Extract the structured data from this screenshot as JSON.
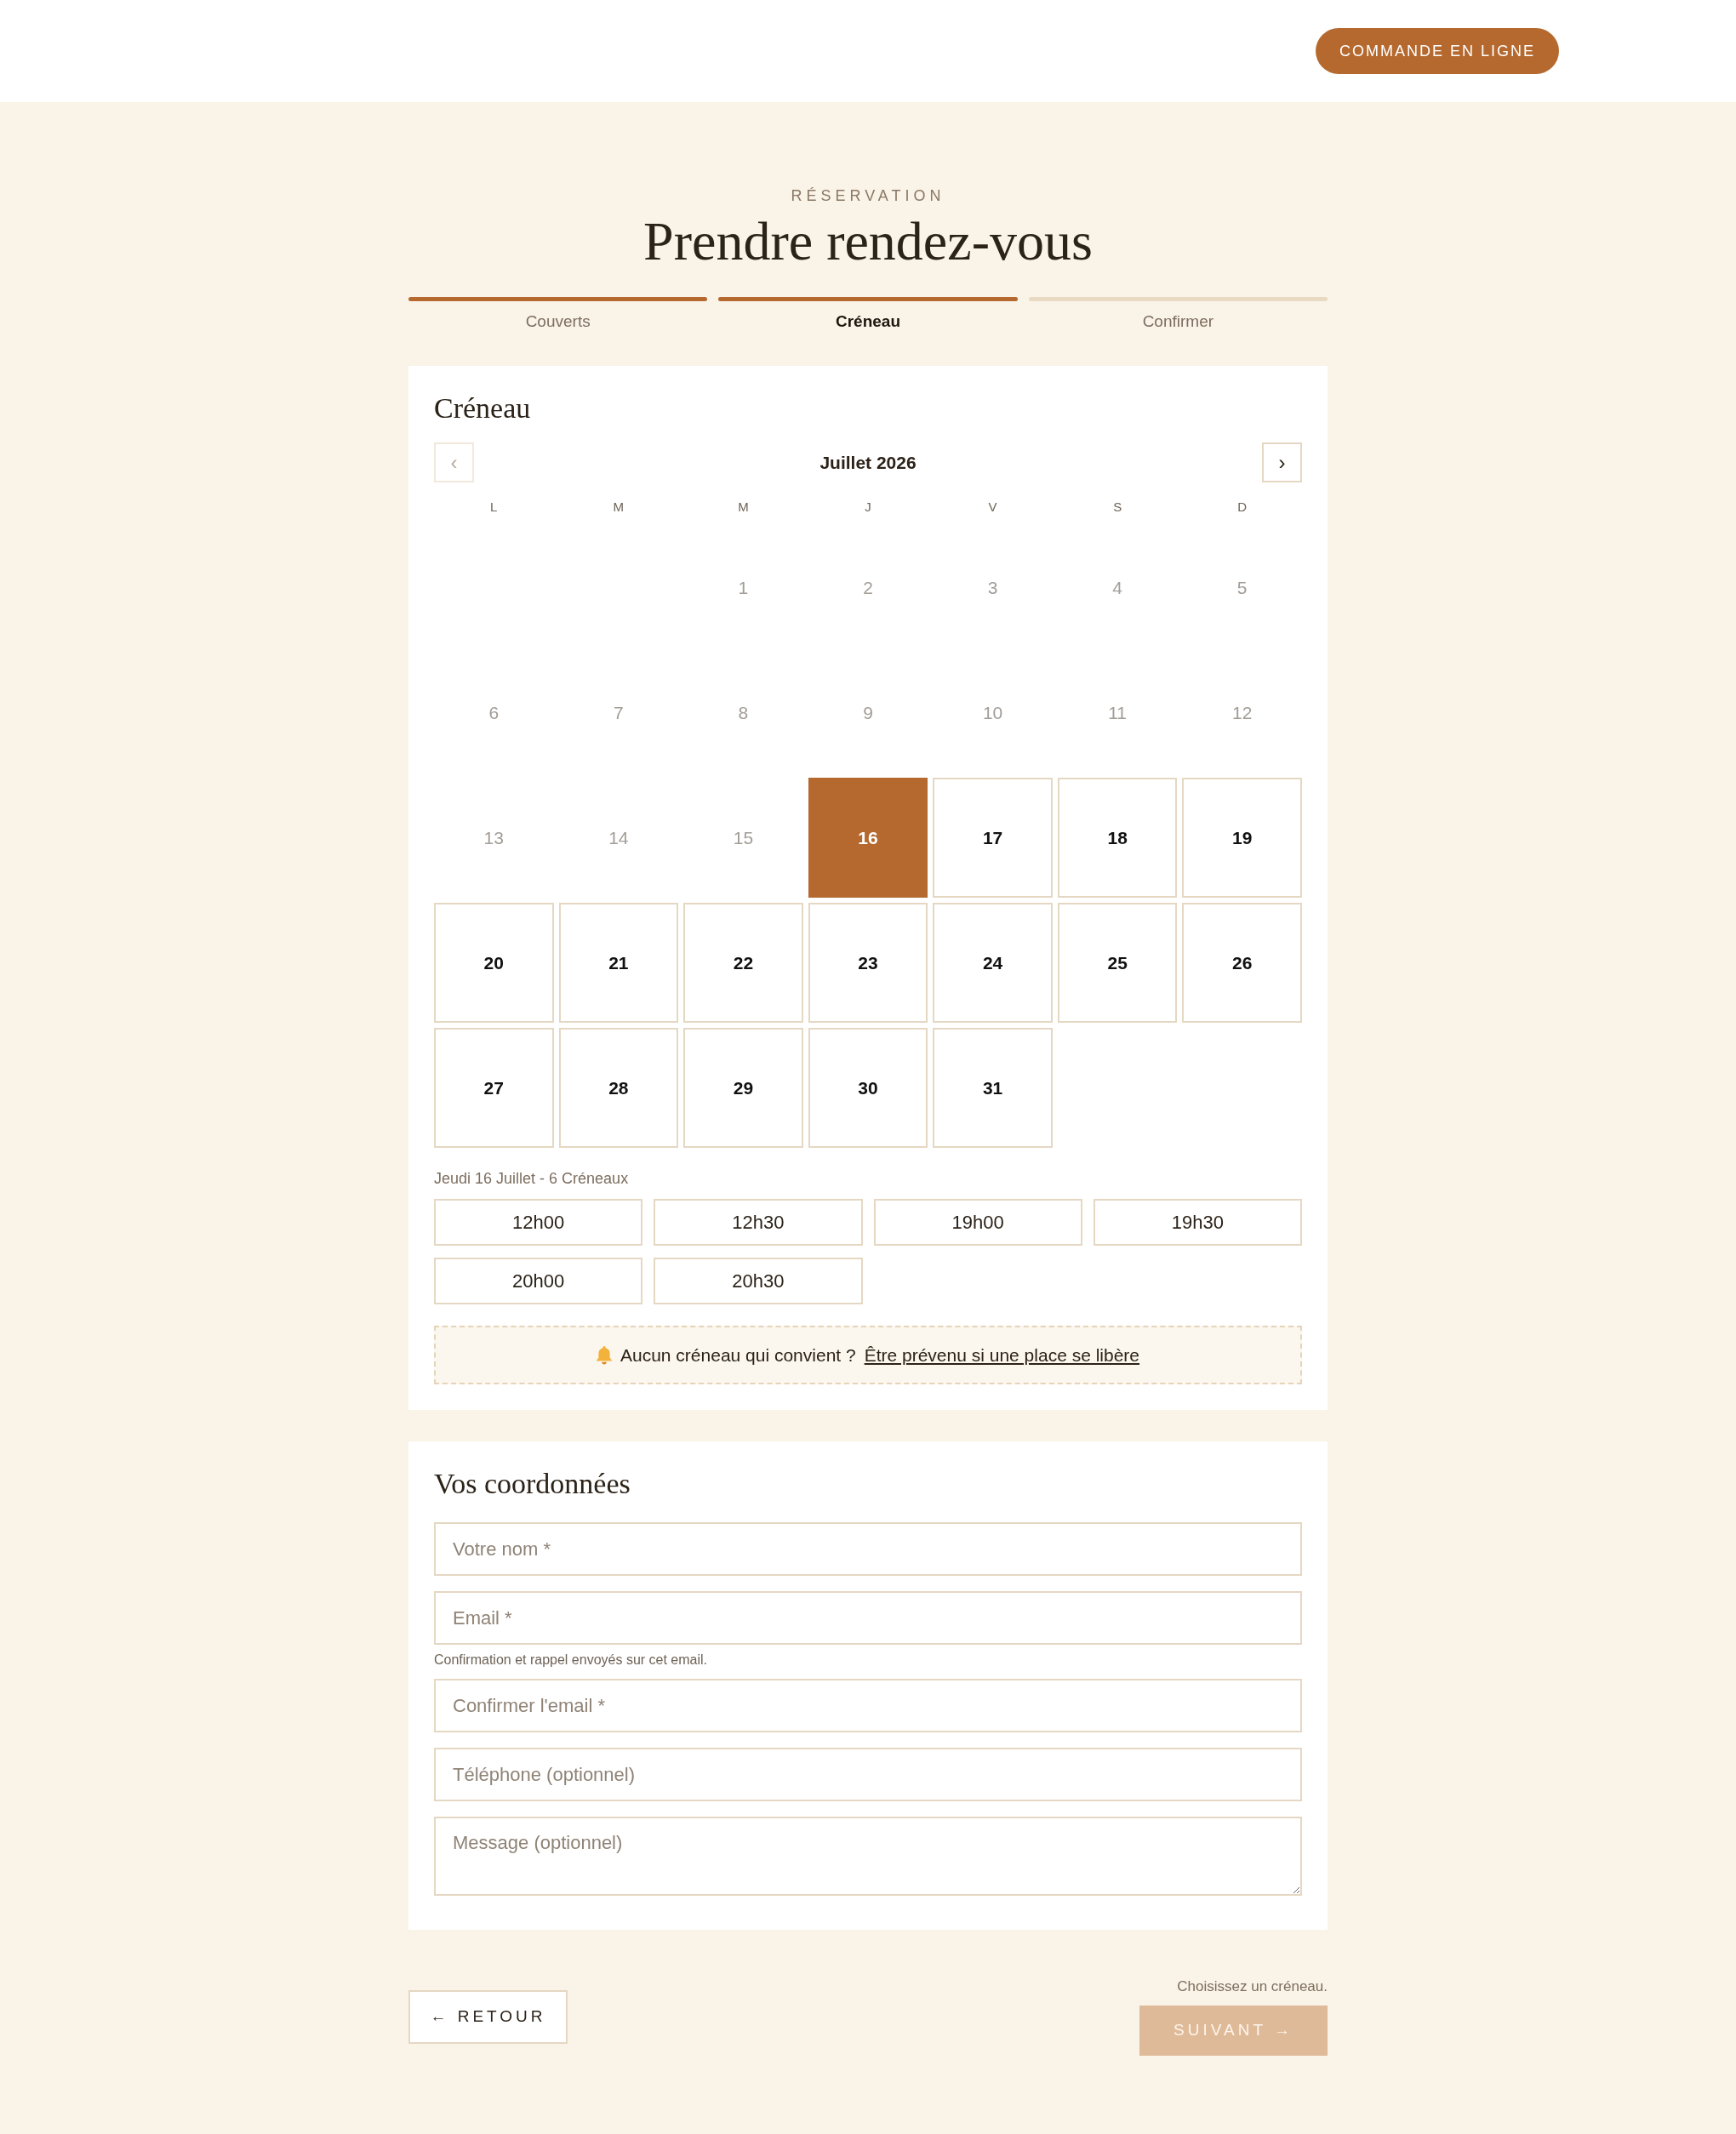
{
  "header": {
    "order_button": "COMMANDE EN LIGNE"
  },
  "intro": {
    "eyebrow": "RÉSERVATION",
    "title": "Prendre rendez-vous"
  },
  "steps": [
    {
      "label": "Couverts",
      "reached": true,
      "selected": false
    },
    {
      "label": "Créneau",
      "reached": true,
      "selected": true
    },
    {
      "label": "Confirmer",
      "reached": false,
      "selected": false
    }
  ],
  "calendar": {
    "title": "Créneau",
    "month": "Juillet 2026",
    "prev": {
      "label": "‹",
      "disabled": true
    },
    "next": {
      "label": "›",
      "disabled": false
    },
    "weekdays": [
      "L",
      "M",
      "M",
      "J",
      "V",
      "S",
      "D"
    ],
    "weeks": [
      [
        {
          "label": "1",
          "disabled": true,
          "selected": false
        },
        {
          "label": "2",
          "disabled": true,
          "selected": false
        },
        {
          "label": "3",
          "disabled": true,
          "selected": false
        },
        {
          "label": "4",
          "disabled": true,
          "selected": false
        },
        {
          "label": "5",
          "disabled": true,
          "selected": false
        }
      ],
      [
        {
          "label": "6",
          "disabled": true,
          "selected": false
        },
        {
          "label": "7",
          "disabled": true,
          "selected": false
        },
        {
          "label": "8",
          "disabled": true,
          "selected": false
        },
        {
          "label": "9",
          "disabled": true,
          "selected": false
        },
        {
          "label": "10",
          "disabled": true,
          "selected": false
        },
        {
          "label": "11",
          "disabled": true,
          "selected": false
        },
        {
          "label": "12",
          "disabled": true,
          "selected": false
        }
      ],
      [
        {
          "label": "13",
          "disabled": true,
          "selected": false
        },
        {
          "label": "14",
          "disabled": true,
          "selected": false
        },
        {
          "label": "15",
          "disabled": true,
          "selected": false
        },
        {
          "label": "16",
          "disabled": false,
          "selected": true
        },
        {
          "label": "17",
          "disabled": false,
          "selected": false
        },
        {
          "label": "18",
          "disabled": false,
          "selected": false
        },
        {
          "label": "19",
          "disabled": false,
          "selected": false
        }
      ],
      [
        {
          "label": "20",
          "disabled": false,
          "selected": false
        },
        {
          "label": "21",
          "disabled": false,
          "selected": false
        },
        {
          "label": "22",
          "disabled": false,
          "selected": false
        },
        {
          "label": "23",
          "disabled": false,
          "selected": false
        },
        {
          "label": "24",
          "disabled": false,
          "selected": false
        },
        {
          "label": "25",
          "disabled": false,
          "selected": false
        },
        {
          "label": "26",
          "disabled": false,
          "selected": false
        }
      ],
      [
        {
          "label": "27",
          "disabled": false,
          "selected": false
        },
        {
          "label": "28",
          "disabled": false,
          "selected": false
        },
        {
          "label": "29",
          "disabled": false,
          "selected": false
        },
        {
          "label": "30",
          "disabled": false,
          "selected": false
        },
        {
          "label": "31",
          "disabled": false,
          "selected": false
        }
      ]
    ],
    "slots_caption": "Jeudi 16 Juillet - 6 Créneaux",
    "slots": [
      {
        "label": "12h00",
        "selected": false
      },
      {
        "label": "12h30",
        "selected": false
      },
      {
        "label": "19h00",
        "selected": false
      },
      {
        "label": "19h30",
        "selected": false
      },
      {
        "label": "20h00",
        "selected": false
      },
      {
        "label": "20h30",
        "selected": false
      }
    ],
    "waitlist": {
      "text": "Aucun créneau qui convient ?",
      "link": "Être prévenu si une place se libère"
    }
  },
  "contact": {
    "title": "Vos coordonnées",
    "fields": [
      {
        "kind": "input",
        "placeholder": "Votre nom *"
      },
      {
        "kind": "input",
        "placeholder": "Email *",
        "help": "Confirmation et rappel envoyés sur cet email."
      },
      {
        "kind": "input",
        "placeholder": "Confirmer l'email *"
      },
      {
        "kind": "input",
        "placeholder": "Téléphone (optionnel)"
      },
      {
        "kind": "textarea",
        "placeholder": "Message (optionnel)"
      }
    ]
  },
  "footer": {
    "back_button": "← RETOUR",
    "hint": "Choisissez un créneau.",
    "next_button": {
      "label": "SUIVANT →",
      "disabled": true
    }
  }
}
